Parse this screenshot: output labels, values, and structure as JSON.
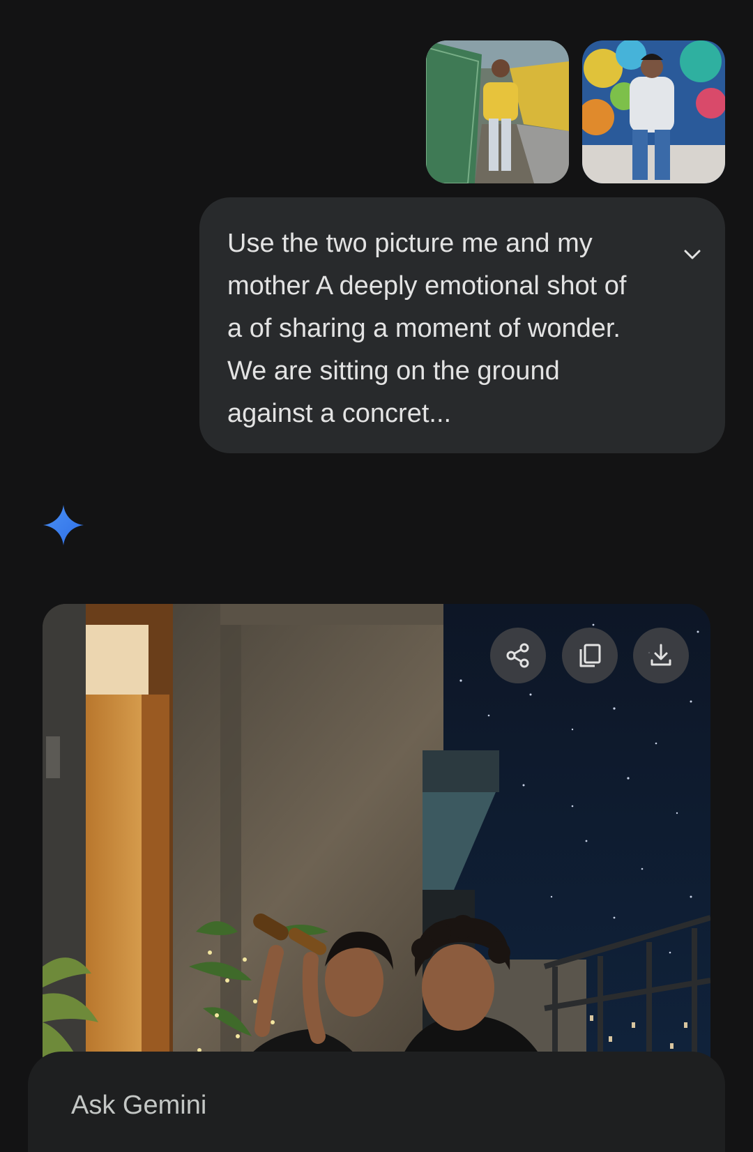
{
  "attachments": [
    {
      "alt_icon": "photo-icon"
    },
    {
      "alt_icon": "photo-icon"
    }
  ],
  "prompt": {
    "text": "Use the two picture me and my mother A deeply emotional shot of a of sharing a moment of wonder. We are sitting on the ground against a concret...",
    "expand_icon": "chevron-down-icon"
  },
  "response": {
    "avatar_icon": "gemini-spark-icon",
    "image_actions": {
      "share_icon": "share-icon",
      "copy_icon": "copy-icon",
      "download_icon": "download-icon"
    }
  },
  "input": {
    "placeholder": "Ask Gemini"
  },
  "colors": {
    "background": "#131314",
    "bubble": "#282a2c",
    "input_bar": "#1e1f20",
    "gemini_blue": "#4285f4"
  }
}
